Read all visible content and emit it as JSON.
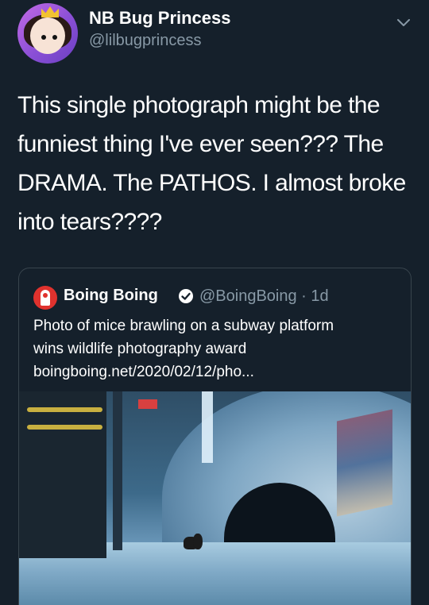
{
  "author": {
    "display_name": "NB Bug Princess",
    "handle": "@lilbugprincess"
  },
  "tweet": {
    "text": "This single photograph might be the funniest thing I've ever seen??? The DRAMA. The PATHOS. I almost broke into tears????"
  },
  "quoted_tweet": {
    "display_name": "Boing Boing",
    "handle_time": "@BoingBoing · 1d",
    "text_line1": "Photo of mice brawling on a subway platform",
    "text_line2": "wins wildlife photography award",
    "link": "boingboing.net/2020/02/12/pho..."
  },
  "colors": {
    "background": "#15202b",
    "secondary_text": "#8899a6",
    "border": "#38444d",
    "brand_red": "#e0322e"
  },
  "icons": {
    "menu": "chevron-down-icon",
    "verified": "verified-badge-icon",
    "quoted_avatar": "boing-boing-logo-icon"
  }
}
